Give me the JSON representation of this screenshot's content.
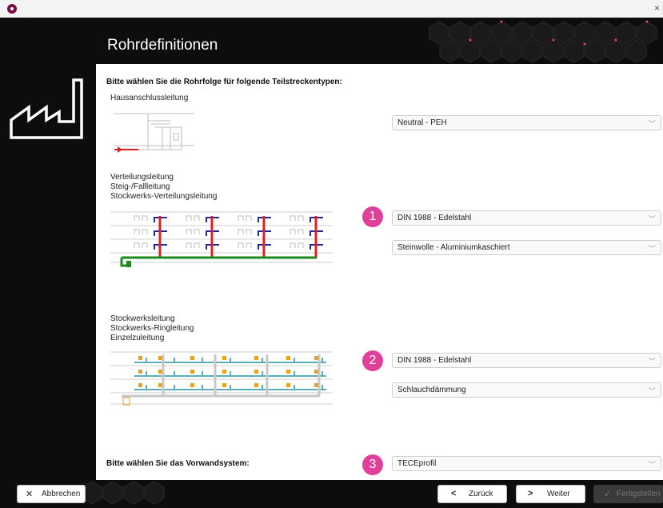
{
  "window": {
    "close_label": "×"
  },
  "header": {
    "title": "Rohrdefinitionen"
  },
  "main": {
    "instruction": "Bitte wählen Sie die Rohrfolge für folgende Teilstreckentypen:",
    "section1": {
      "label": "Hausanschlussleitung",
      "pipe": "Neutral - PEH"
    },
    "section2": {
      "labels": [
        "Verteilungsleitung",
        "Steig-/Fallleitung",
        "Stockwerks-Verteilungsleitung"
      ],
      "badge": "1",
      "pipe": "DIN 1988 - Edelstahl",
      "insulation": "Steinwolle - Aluminiumkaschiert"
    },
    "section3": {
      "labels": [
        "Stockwerksleitung",
        "Stockwerks-Ringleitung",
        "Einzelzuleitung"
      ],
      "badge": "2",
      "pipe": "DIN 1988 - Edelstahl",
      "insulation": "Schlauchdämmung"
    },
    "wall_system": {
      "label": "Bitte wählen Sie das Vorwandsystem:",
      "badge": "3",
      "value": "TECEprofil"
    }
  },
  "footer": {
    "cancel": "Abbrechen",
    "back": "Zurück",
    "next": "Weiter",
    "finish": "Fertigstellen"
  },
  "colors": {
    "accent": "#e0409a",
    "dark": "#0d0d0d"
  }
}
